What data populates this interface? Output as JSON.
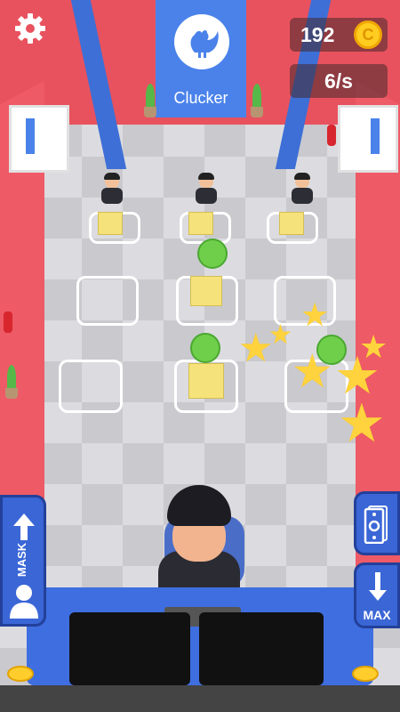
{
  "brand": {
    "name": "Clucker",
    "logo_icon": "rooster-icon"
  },
  "hud": {
    "coins": "192",
    "coin_icon": "coin-icon",
    "coin_symbol": "C",
    "rate": "6/s",
    "settings_icon": "gear-icon"
  },
  "buttons": {
    "mask_label": "MASK",
    "mask_icon": "up-arrow-icon",
    "profile_icon": "person-icon",
    "money_icon": "money-stack-icon",
    "max_label": "MAX",
    "max_icon": "down-arrow-icon"
  },
  "colors": {
    "wall": "#e8525e",
    "accent_blue": "#3a66d6",
    "coin_gold": "#ffcc1f",
    "star_yellow": "#ffd33d"
  }
}
